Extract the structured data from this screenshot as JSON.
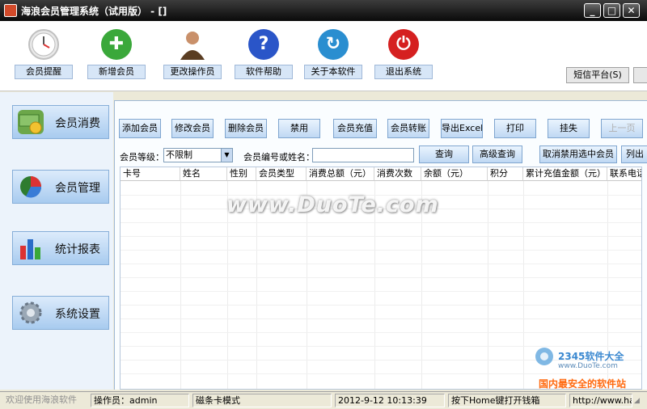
{
  "window": {
    "title": "海浪会员管理系统（试用版） - []",
    "btn_min": "_",
    "btn_max": "□",
    "btn_close": "✕"
  },
  "toolbar": {
    "items": [
      {
        "label": "会员提醒",
        "icon": "clock-icon",
        "color": "#e9e9e9"
      },
      {
        "label": "新增会员",
        "icon": "plus-icon",
        "color": "#3aa83a"
      },
      {
        "label": "更改操作员",
        "icon": "person-icon",
        "color": "#6b4a2a"
      },
      {
        "label": "软件帮助",
        "icon": "help-icon",
        "color": "#2a55c8"
      },
      {
        "label": "关于本软件",
        "icon": "refresh-icon",
        "color": "#2a8ed0"
      },
      {
        "label": "退出系统",
        "icon": "power-icon",
        "color": "#d52020"
      }
    ],
    "sms": "短信平台(S)"
  },
  "nav": [
    {
      "label": "会员消费",
      "icon": "money-icon",
      "color": "#6ca74a"
    },
    {
      "label": "会员管理",
      "icon": "pie-chart-icon",
      "color": "#2f7c2f"
    },
    {
      "label": "统计报表",
      "icon": "bar-chart-icon",
      "color": "#2a6cc8"
    },
    {
      "label": "系统设置",
      "icon": "gear-icon",
      "color": "#8a9aaa"
    }
  ],
  "actions": [
    "添加会员",
    "修改会员",
    "删除会员",
    "禁用",
    "会员充值",
    "会员转账",
    "导出Excel",
    "打印",
    "挂失",
    "上一页"
  ],
  "filter": {
    "level_label": "会员等级：",
    "level_value": "不限制",
    "search_label": "会员编号或姓名：",
    "search_value": "",
    "query": "查询",
    "advanced": "高级查询",
    "cancel_disabled": "取消禁用选中会员",
    "columns": "列出"
  },
  "table": {
    "columns": [
      "卡号",
      "姓名",
      "性别",
      "会员类型",
      "消费总额（元）",
      "消费次数",
      "余额（元）",
      "积分",
      "累计充值金额（元）",
      "联系电话"
    ]
  },
  "watermark": "www.DuoTe.com",
  "corner_logo": {
    "brand": "2345软件大全",
    "url": "www.DuoTe.com",
    "slogan": "国内最安全的软件站"
  },
  "status": {
    "welcome": "欢迎使用海浪软件",
    "operator": "操作员：admin",
    "mode": "磁条卡模式",
    "datetime": "2012-9-12 10:13:39",
    "hint": "按下Home键打开钱箱",
    "url": "http://www.hai"
  }
}
